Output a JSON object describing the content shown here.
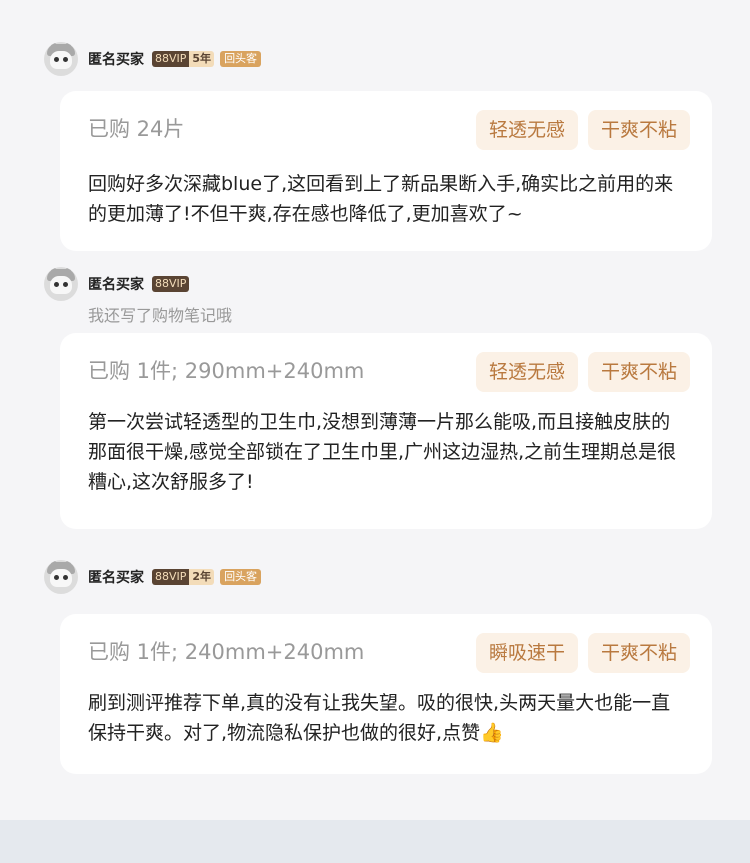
{
  "reviews": [
    {
      "user": "匿名买家",
      "vip": "88VIP",
      "vip_years": "5年",
      "repeat_badge": "回头客",
      "note": "",
      "purchase": "已购 24片",
      "tags": [
        "轻透无感",
        "干爽不粘"
      ],
      "content": "回购好多次深藏blue了,这回看到上了新品果断入手,确实比之前用的来的更加薄了!不但干爽,存在感也降低了,更加喜欢了~"
    },
    {
      "user": "匿名买家",
      "vip": "88VIP",
      "vip_years": "",
      "repeat_badge": "",
      "note": "我还写了购物笔记哦",
      "purchase": "已购 1件; 290mm+240mm",
      "tags": [
        "轻透无感",
        "干爽不粘"
      ],
      "content": "第一次尝试轻透型的卫生巾,没想到薄薄一片那么能吸,而且接触皮肤的那面很干燥,感觉全部锁在了卫生巾里,广州这边湿热,之前生理期总是很糟心,这次舒服多了!"
    },
    {
      "user": "匿名买家",
      "vip": "88VIP",
      "vip_years": "2年",
      "repeat_badge": "回头客",
      "note": "",
      "purchase": "已购 1件; 240mm+240mm",
      "tags": [
        "瞬吸速干",
        "干爽不粘"
      ],
      "content": "刷到测评推荐下单,真的没有让我失望。吸的很快,头两天量大也能一直保持干爽。对了,物流隐私保护也做的很好,点赞👍"
    }
  ]
}
